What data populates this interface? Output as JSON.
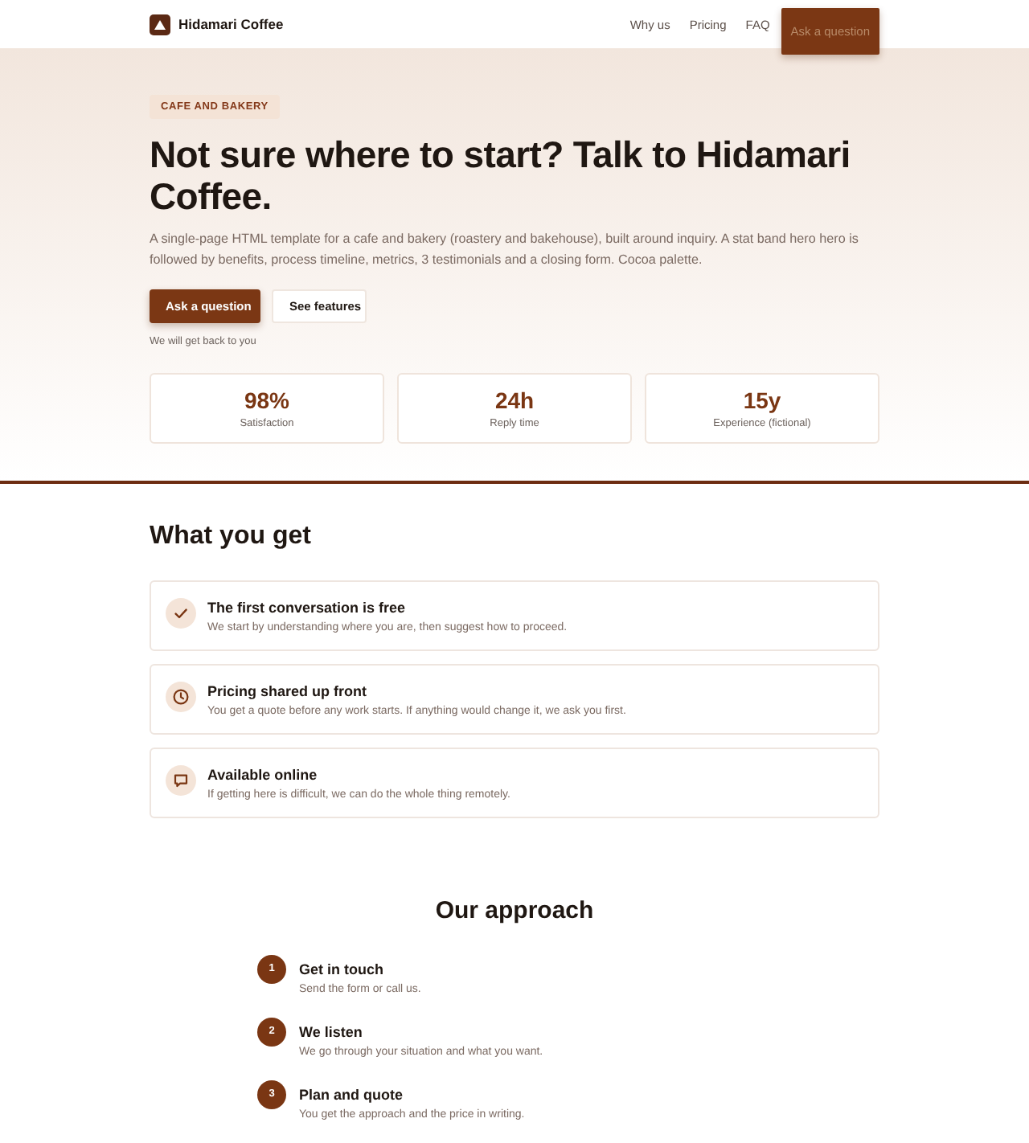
{
  "header": {
    "brand": "Hidamari Coffee",
    "nav": [
      {
        "label": "Why us"
      },
      {
        "label": "Pricing"
      },
      {
        "label": "FAQ"
      }
    ],
    "cta": {
      "label": "Ask a question"
    }
  },
  "hero": {
    "badge": "CAFE AND BAKERY",
    "title": "Not sure where to start? Talk to Hidamari Coffee.",
    "description": "A single-page HTML template for a cafe and bakery (roastery and bakehouse), built around inquiry. A stat band hero hero is followed by benefits, process timeline, metrics, 3 testimonials and a closing form. Cocoa palette.",
    "buttons": [
      {
        "label": "Ask a question",
        "kind": "primary"
      },
      {
        "label": "See features",
        "kind": "secondary"
      }
    ],
    "note": "We will get back to you",
    "stats": [
      {
        "value": "98%",
        "label": "Satisfaction"
      },
      {
        "value": "24h",
        "label": "Reply time"
      },
      {
        "value": "15y",
        "label": "Experience (fictional)"
      }
    ]
  },
  "benefits": {
    "title": "What you get",
    "items": [
      {
        "title": "The first conversation is free",
        "text": "We start by understanding where you are, then suggest how to proceed."
      },
      {
        "title": "Pricing shared up front",
        "text": "You get a quote before any work starts. If anything would change it, we ask you first."
      },
      {
        "title": "Available online",
        "text": "If getting here is difficult, we can do the whole thing remotely."
      }
    ]
  },
  "approach": {
    "title": "Our approach",
    "steps": [
      {
        "number": "1",
        "title": "Get in touch",
        "text": "Send the form or call us."
      },
      {
        "number": "2",
        "title": "We listen",
        "text": "We go through your situation and what you want."
      },
      {
        "number": "3",
        "title": "Plan and quote",
        "text": "You get the approach and the price in writing."
      }
    ]
  }
}
